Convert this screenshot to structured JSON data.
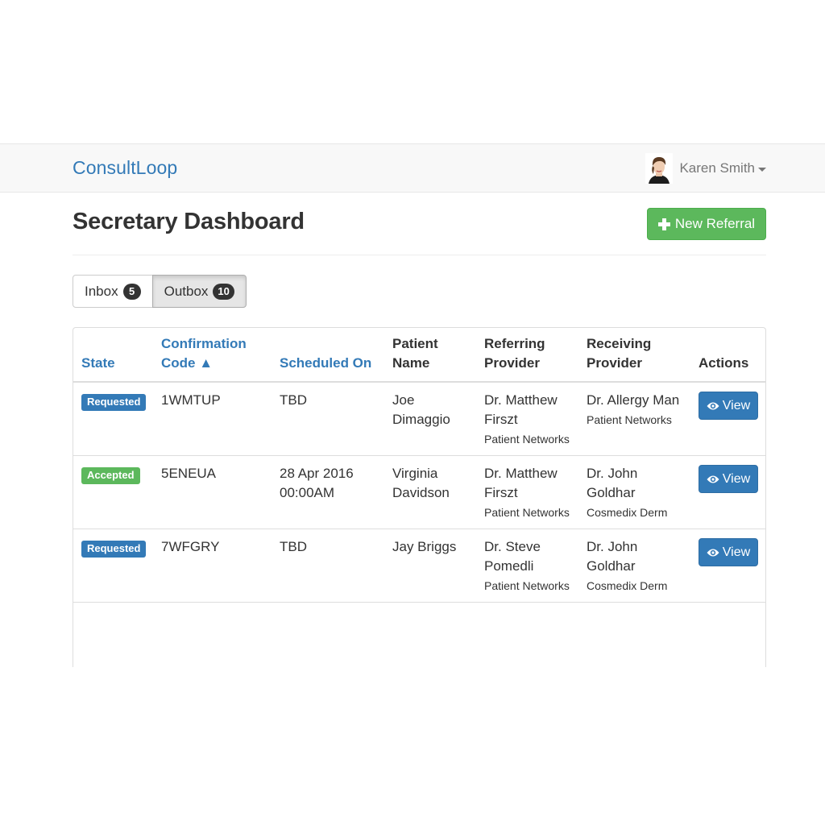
{
  "navbar": {
    "brand": "ConsultLoop",
    "user_name": "Karen Smith"
  },
  "header": {
    "title": "Secretary Dashboard",
    "new_referral_label": "New Referral"
  },
  "tabs": [
    {
      "label": "Inbox",
      "count": "5"
    },
    {
      "label": "Outbox",
      "count": "10"
    }
  ],
  "table": {
    "headers": {
      "state": "State",
      "confirmation_code_line1": "Confirmation",
      "confirmation_code_line2": "Code ▲",
      "scheduled_on": "Scheduled On",
      "patient_name_line1": "Patient",
      "patient_name_line2": "Name",
      "referring_line1": "Referring",
      "referring_line2": "Provider",
      "receiving_line1": "Receiving",
      "receiving_line2": "Provider",
      "actions": "Actions"
    },
    "rows": [
      {
        "state": "Requested",
        "code": "1WMTUP",
        "scheduled_line1": "TBD",
        "scheduled_line2": "",
        "patient": "Joe Dimaggio",
        "referring_name": "Dr. Matthew Firszt",
        "referring_org": "Patient Networks",
        "receiving_name": "Dr. Allergy Man",
        "receiving_org": "Patient Networks",
        "action": "View"
      },
      {
        "state": "Accepted",
        "code": "5ENEUA",
        "scheduled_line1": "28 Apr 2016",
        "scheduled_line2": "00:00AM",
        "patient": "Virginia Davidson",
        "referring_name": "Dr. Matthew Firszt",
        "referring_org": "Patient Networks",
        "receiving_name": "Dr. John Goldhar",
        "receiving_org": "Cosmedix Derm",
        "action": "View"
      },
      {
        "state": "Requested",
        "code": "7WFGRY",
        "scheduled_line1": "TBD",
        "scheduled_line2": "",
        "patient": "Jay Briggs",
        "referring_name": "Dr. Steve Pomedli",
        "referring_org": "Patient Networks",
        "receiving_name": "Dr. John Goldhar",
        "receiving_org": "Cosmedix Derm",
        "action": "View"
      }
    ]
  },
  "colors": {
    "brand": "#337ab7",
    "success": "#5cb85c",
    "primary": "#337ab7",
    "badge": "#333333"
  },
  "icons": {
    "new_referral": "plus-icon",
    "view": "eye-icon",
    "user_menu": "caret-down-icon"
  }
}
